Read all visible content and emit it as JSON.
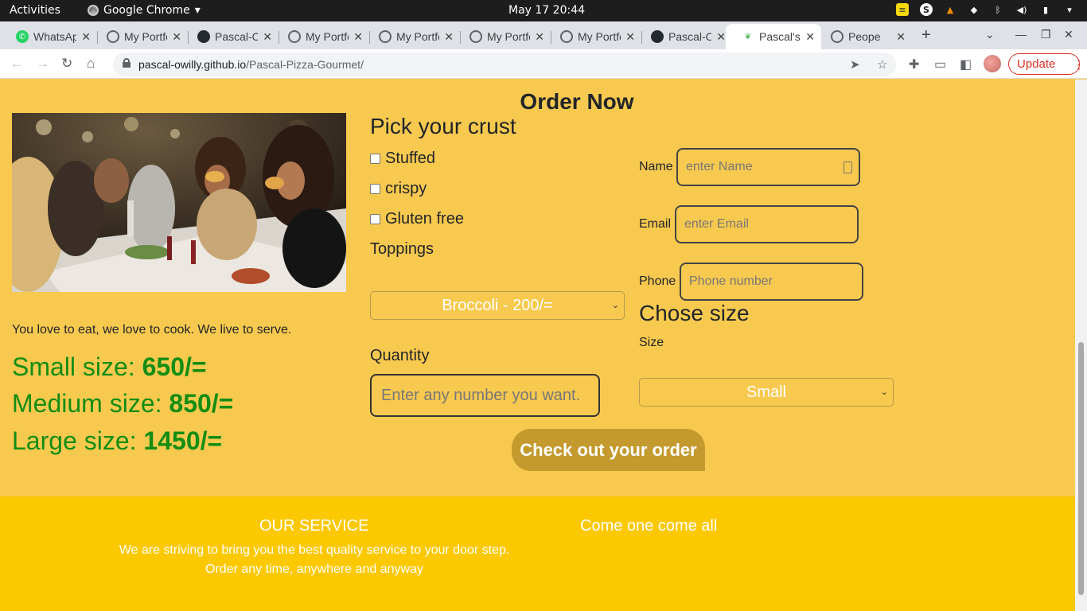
{
  "system": {
    "activities": "Activities",
    "app_name": "Google Chrome",
    "clock": "May 17  20:44"
  },
  "tabs": [
    {
      "title": "WhatsApp",
      "icon": "whatsapp-icon"
    },
    {
      "title": "My Portfolio",
      "icon": "globe-icon"
    },
    {
      "title": "Pascal-Owilly",
      "icon": "github-icon"
    },
    {
      "title": "My Portfolio",
      "icon": "globe-icon"
    },
    {
      "title": "My Portfolio",
      "icon": "globe-icon"
    },
    {
      "title": "My Portfolio",
      "icon": "globe-icon"
    },
    {
      "title": "My Portfolio",
      "icon": "globe-icon"
    },
    {
      "title": "Pascal-Owilly",
      "icon": "github-icon"
    },
    {
      "title": "Pascal's",
      "icon": "leaf-icon",
      "active": true
    },
    {
      "title": "Peope",
      "icon": "globe-icon"
    }
  ],
  "address": {
    "host": "pascal-owilly.github.io",
    "path": "/Pascal-Pizza-Gourmet/"
  },
  "update_label": "Update",
  "page": {
    "order_title": "Order Now",
    "tagline": "You love to eat, we love to cook. We live to serve.",
    "prices": [
      {
        "label": "Small size: ",
        "value": "650/="
      },
      {
        "label": "Medium size: ",
        "value": "850/="
      },
      {
        "label": "Large size: ",
        "value": "1450/="
      }
    ],
    "crust_title": "Pick your crust",
    "crust_options": [
      "Stuffed",
      "crispy",
      "Gluten free"
    ],
    "toppings_label": "Toppings",
    "toppings_selected": "Broccoli - 200/=",
    "quantity_label": "Quantity",
    "quantity_placeholder": "Enter any number you want.",
    "checkout_label": "Check out your order",
    "name_label": "Name",
    "name_placeholder": "enter Name",
    "email_label": "Email",
    "email_placeholder": "enter Email",
    "phone_label": "Phone",
    "phone_placeholder": "Phone number",
    "size_title": "Chose size",
    "size_label": "Size",
    "size_selected": "Small"
  },
  "footer": {
    "service_title": "OUR SERVICE",
    "service_line1": "We are striving to bring you the best quality service to your door step.",
    "service_line2": "Order any time, anywhere and anyway",
    "welcome": "Come one come all"
  },
  "colors": {
    "page_bg": "#f8c94f",
    "footer_bg": "#fcc800",
    "price_green": "#138d13",
    "button_bg": "#c49a2e"
  }
}
